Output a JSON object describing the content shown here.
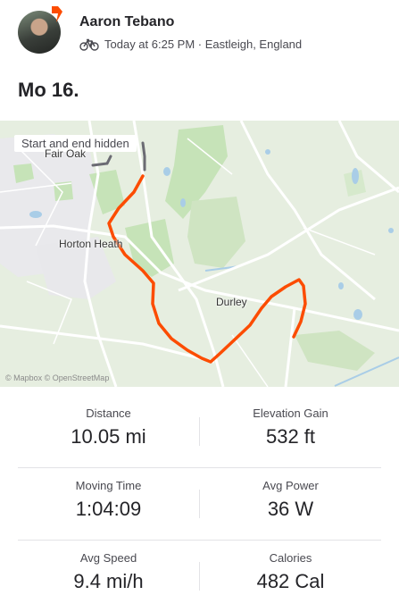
{
  "activity": {
    "athlete_name": "Aaron Tebano",
    "meta": "Today at 6:25 PM · Eastleigh, England",
    "activity_type_icon": "bike-icon",
    "title": "Mo 16."
  },
  "map": {
    "privacy_badge": "Start and end hidden",
    "labels": {
      "fair_oak": "Fair Oak",
      "horton_heath": "Horton Heath",
      "durley": "Durley"
    },
    "attribution": "© Mapbox © OpenStreetMap",
    "route_color": "#fc4c02"
  },
  "stats": [
    {
      "left": {
        "label": "Distance",
        "value": "10.05 mi"
      },
      "right": {
        "label": "Elevation Gain",
        "value": "532 ft"
      }
    },
    {
      "left": {
        "label": "Moving Time",
        "value": "1:04:09"
      },
      "right": {
        "label": "Avg Power",
        "value": "36 W"
      }
    },
    {
      "left": {
        "label": "Avg Speed",
        "value": "9.4 mi/h"
      },
      "right": {
        "label": "Calories",
        "value": "482 Cal"
      }
    }
  ]
}
